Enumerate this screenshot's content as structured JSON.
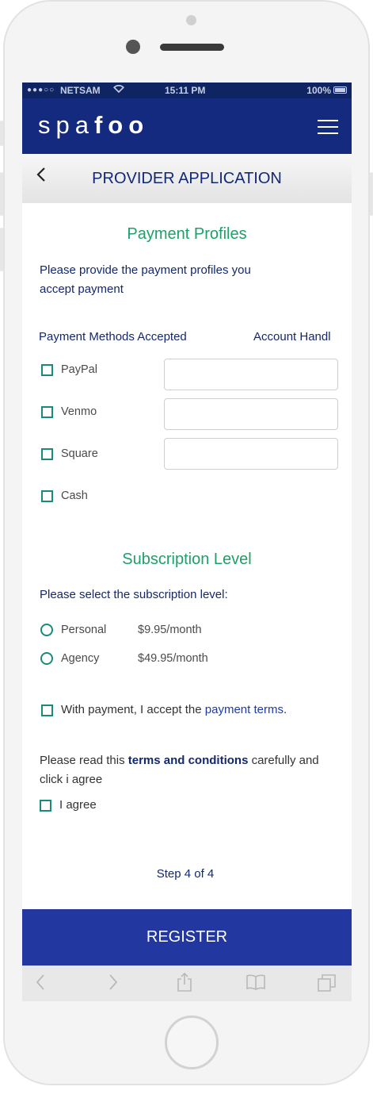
{
  "status_bar": {
    "signal": "●●●○○",
    "carrier": "NETSAM",
    "time": "15:11 PM",
    "battery": "100%"
  },
  "brand": {
    "logo_light": "spa",
    "logo_bold": "foo"
  },
  "header": {
    "back_icon": "‹",
    "title": "PROVIDER APPLICATION"
  },
  "payment": {
    "heading": "Payment Profiles",
    "intro_line1": "Please provide the payment profiles you",
    "intro_line2": "accept payment",
    "col_methods": "Payment Methods Accepted",
    "col_handle": "Account Handl",
    "methods": [
      {
        "label": "PayPal",
        "checked": false,
        "handle": ""
      },
      {
        "label": "Venmo",
        "checked": false,
        "handle": ""
      },
      {
        "label": "Square",
        "checked": false,
        "handle": ""
      },
      {
        "label": "Cash",
        "checked": false
      }
    ]
  },
  "subscription": {
    "heading": "Subscription Level",
    "prompt": "Please select the subscription level:",
    "options": [
      {
        "label": "Personal",
        "price": "$9.95/month"
      },
      {
        "label": "Agency",
        "price": "$49.95/month"
      }
    ]
  },
  "payment_terms": {
    "prefix": "With payment, I accept the ",
    "link": "payment terms",
    "suffix": "."
  },
  "terms": {
    "prefix": "Please read this ",
    "link": "terms and conditions",
    "suffix": " carefully and",
    "line2": "click i agree",
    "agree_label": "I agree"
  },
  "step": "Step 4 of 4",
  "register_label": "REGISTER",
  "colors": {
    "navy": "#142a7e",
    "green": "#1fa06a",
    "button": "#22379f",
    "checkbox": "#1b8a7a"
  }
}
